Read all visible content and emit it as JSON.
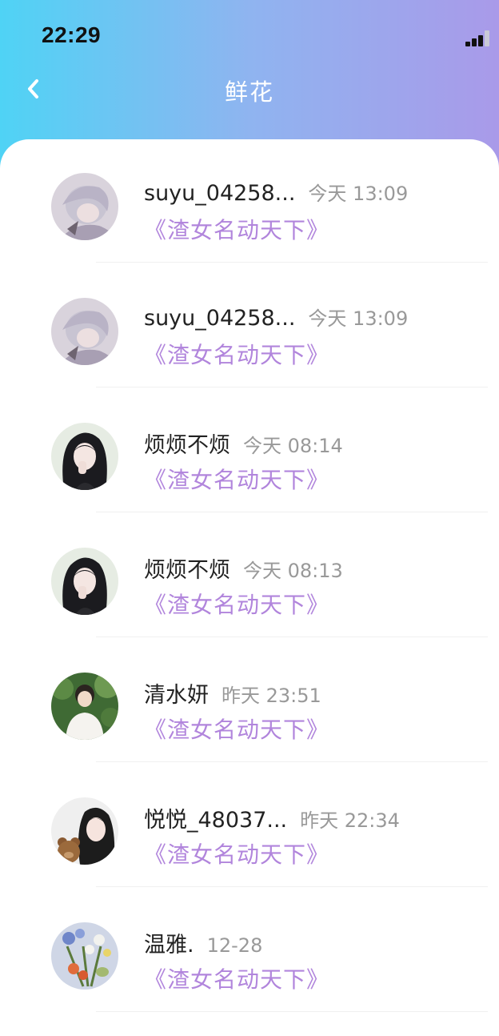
{
  "status_bar": {
    "time": "22:29"
  },
  "nav": {
    "title": "鲜花",
    "back_icon": "chevron-left-icon"
  },
  "items": [
    {
      "name": "suyu_04258...",
      "time": "今天 13:09",
      "book": "《渣女名动天下》",
      "avatar": "anime-boy"
    },
    {
      "name": "suyu_04258...",
      "time": "今天 13:09",
      "book": "《渣女名动天下》",
      "avatar": "anime-boy"
    },
    {
      "name": "烦烦不烦",
      "time": "今天 08:14",
      "book": "《渣女名动天下》",
      "avatar": "girl-dark-hair"
    },
    {
      "name": "烦烦不烦",
      "time": "今天 08:13",
      "book": "《渣女名动天下》",
      "avatar": "girl-dark-hair"
    },
    {
      "name": "清水妍",
      "time": "昨天 23:51",
      "book": "《渣女名动天下》",
      "avatar": "boy-green-background"
    },
    {
      "name": "悦悦_48037...",
      "time": "昨天 22:34",
      "book": "《渣女名动天下》",
      "avatar": "girl-with-bear"
    },
    {
      "name": "温雅.",
      "time": "12-28",
      "book": "《渣女名动天下》",
      "avatar": "flowers"
    }
  ],
  "colors": {
    "accent": "#b185dc",
    "header_start": "#4fd3f5",
    "header_end": "#a99ae9"
  }
}
